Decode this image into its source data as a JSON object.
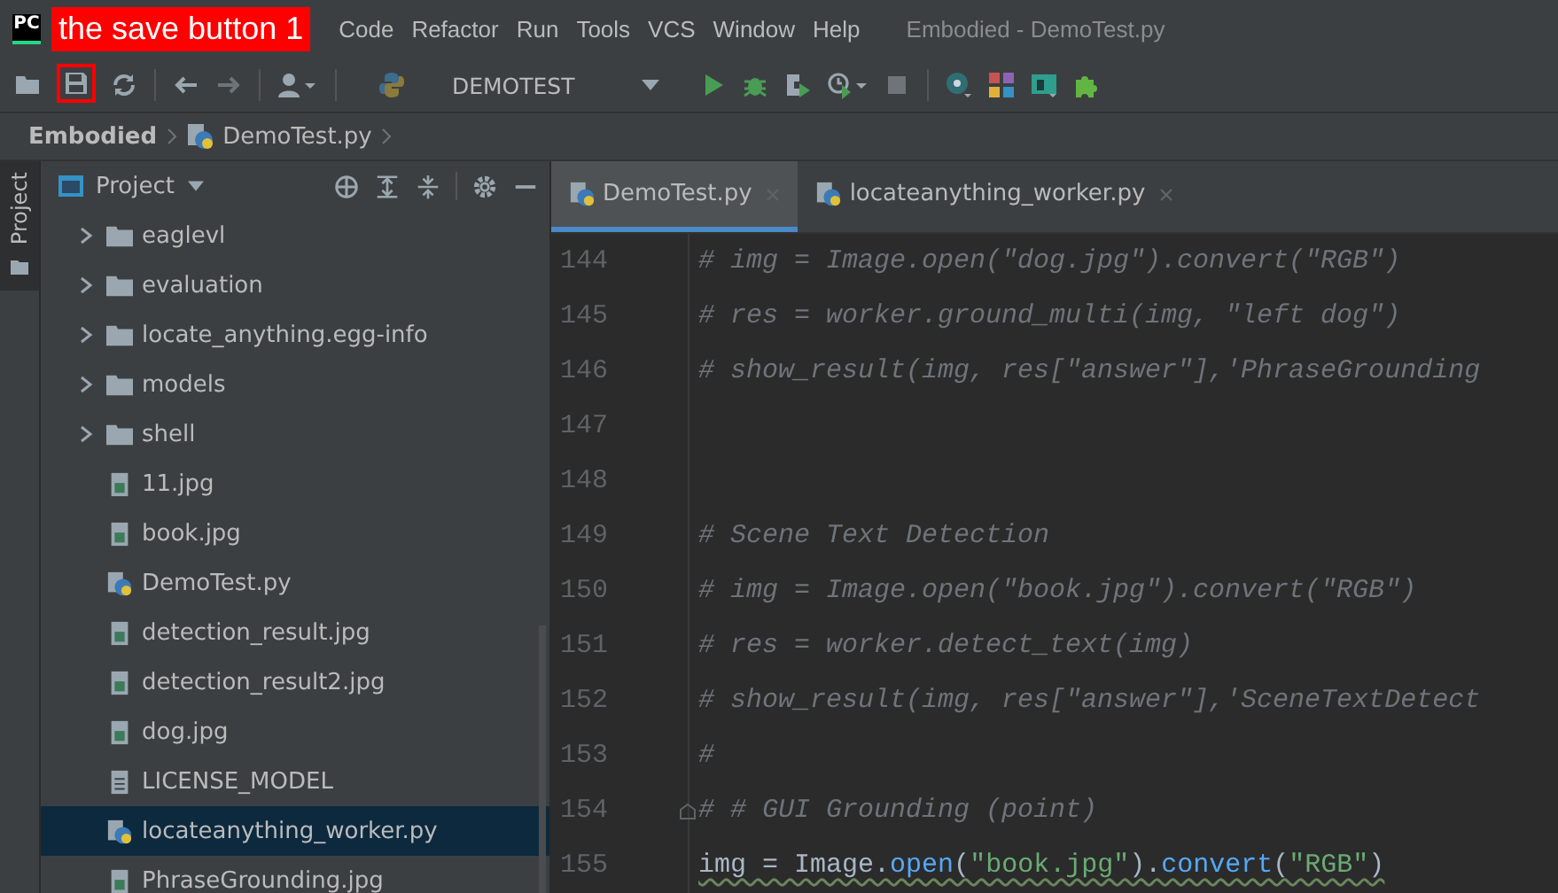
{
  "window": {
    "logo": "PC",
    "title": "Embodied - DemoTest.py"
  },
  "annotation": {
    "label": "the save button 1"
  },
  "menu": [
    "Code",
    "Refactor",
    "Run",
    "Tools",
    "VCS",
    "Window",
    "Help"
  ],
  "toolbar": {
    "run_config": "DEMOTEST"
  },
  "breadcrumb": [
    {
      "label": "Embodied",
      "kind": "project"
    },
    {
      "label": "DemoTest.py",
      "kind": "python"
    }
  ],
  "side_tab": {
    "label": "Project",
    "selected": true
  },
  "project_panel": {
    "title": "Project",
    "items": [
      {
        "label": "eaglevl",
        "kind": "folder",
        "expanded": false,
        "selected": false
      },
      {
        "label": "evaluation",
        "kind": "folder",
        "expanded": false,
        "selected": false
      },
      {
        "label": "locate_anything.egg-info",
        "kind": "folder",
        "expanded": false,
        "selected": false
      },
      {
        "label": "models",
        "kind": "folder",
        "expanded": false,
        "selected": false
      },
      {
        "label": "shell",
        "kind": "folder",
        "expanded": false,
        "selected": false
      },
      {
        "label": "11.jpg",
        "kind": "image",
        "selected": false
      },
      {
        "label": "book.jpg",
        "kind": "image",
        "selected": false
      },
      {
        "label": "DemoTest.py",
        "kind": "python",
        "selected": false
      },
      {
        "label": "detection_result.jpg",
        "kind": "image",
        "selected": false
      },
      {
        "label": "detection_result2.jpg",
        "kind": "image",
        "selected": false
      },
      {
        "label": "dog.jpg",
        "kind": "image",
        "selected": false
      },
      {
        "label": "LICENSE_MODEL",
        "kind": "text",
        "selected": false
      },
      {
        "label": "locateanything_worker.py",
        "kind": "python",
        "selected": true
      },
      {
        "label": "PhraseGrounding.jpg",
        "kind": "image",
        "selected": false
      }
    ]
  },
  "tabs": [
    {
      "label": "DemoTest.py",
      "selected": true
    },
    {
      "label": "locateanything_worker.py",
      "selected": false
    }
  ],
  "editor": {
    "lines": [
      {
        "number": "144",
        "kind": "comment",
        "text": "# img = Image.open(\"dog.jpg\").convert(\"RGB\")"
      },
      {
        "number": "145",
        "kind": "comment",
        "text": "# res = worker.ground_multi(img, \"left dog\")"
      },
      {
        "number": "146",
        "kind": "comment",
        "text": "# show_result(img, res[\"answer\"],'PhraseGrounding"
      },
      {
        "number": "147",
        "kind": "blank"
      },
      {
        "number": "148",
        "kind": "blank"
      },
      {
        "number": "149",
        "kind": "comment",
        "text": "# Scene Text Detection"
      },
      {
        "number": "150",
        "kind": "comment",
        "text": "# img = Image.open(\"book.jpg\").convert(\"RGB\")"
      },
      {
        "number": "151",
        "kind": "comment",
        "text": "# res = worker.detect_text(img)"
      },
      {
        "number": "152",
        "kind": "comment",
        "text": "# show_result(img, res[\"answer\"],'SceneTextDetect"
      },
      {
        "number": "153",
        "kind": "comment",
        "text": "#"
      },
      {
        "number": "154",
        "kind": "comment",
        "text": "# # GUI Grounding (point)",
        "fold": true
      },
      {
        "number": "155",
        "kind": "code",
        "tokens": [
          {
            "text": "img = Image.",
            "kind": "plain"
          },
          {
            "text": "open",
            "kind": "function"
          },
          {
            "text": "(",
            "kind": "plain"
          },
          {
            "text": "\"book.jpg\"",
            "kind": "string"
          },
          {
            "text": ").",
            "kind": "plain"
          },
          {
            "text": "convert",
            "kind": "function"
          },
          {
            "text": "(",
            "kind": "plain"
          },
          {
            "text": "\"RGB\"",
            "kind": "string"
          },
          {
            "text": ")",
            "kind": "plain"
          }
        ]
      }
    ]
  }
}
